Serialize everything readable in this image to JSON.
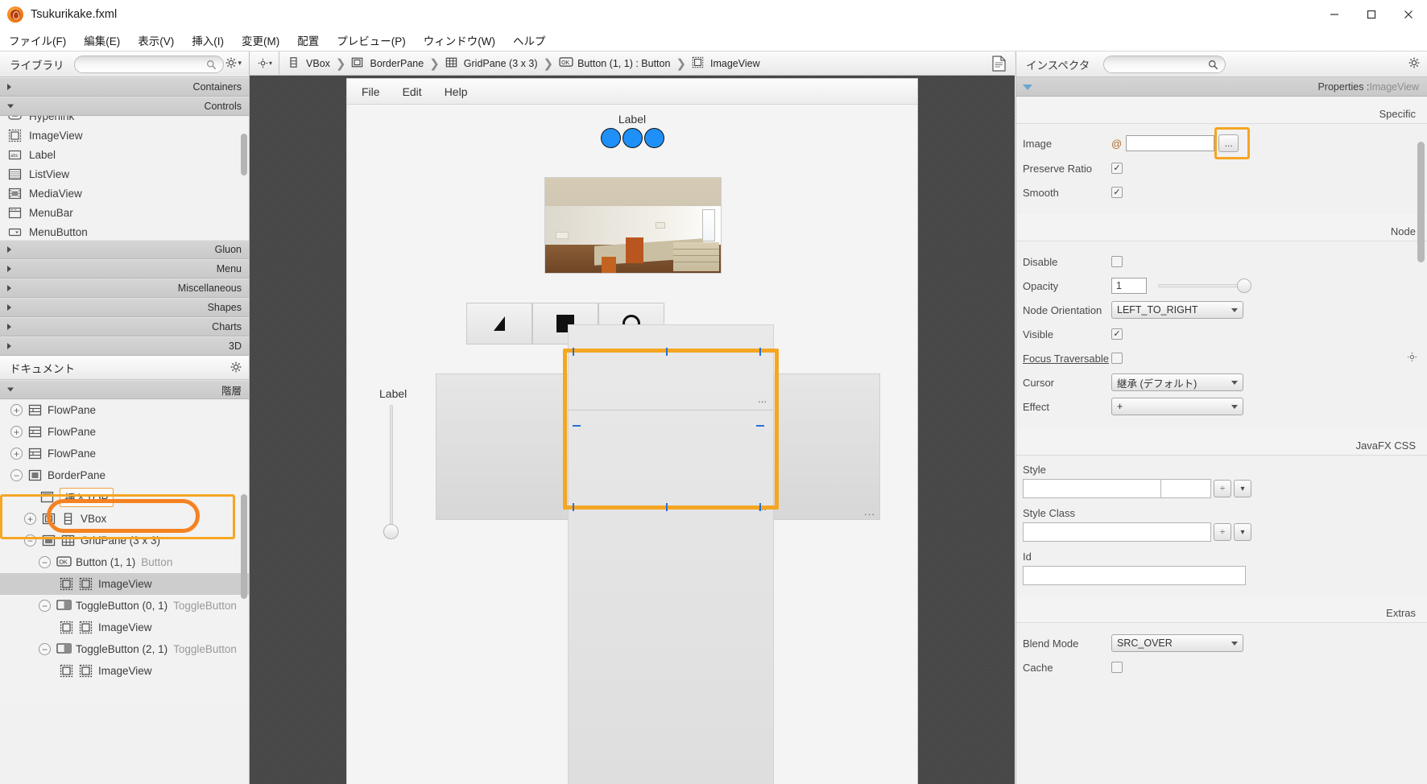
{
  "window": {
    "title": "Tsukurikake.fxml",
    "app_icon": "scenebuilder-icon",
    "minimize": "−",
    "maximize": "▢",
    "close": "✕"
  },
  "menubar": {
    "items": [
      {
        "label": "ファイル(F)",
        "name": "menu-file"
      },
      {
        "label": "編集(E)",
        "name": "menu-edit"
      },
      {
        "label": "表示(V)",
        "name": "menu-view"
      },
      {
        "label": "挿入(I)",
        "name": "menu-insert"
      },
      {
        "label": "変更(M)",
        "name": "menu-modify"
      },
      {
        "label": "配置",
        "name": "menu-arrange"
      },
      {
        "label": "プレビュー(P)",
        "name": "menu-preview"
      },
      {
        "label": "ウィンドウ(W)",
        "name": "menu-window"
      },
      {
        "label": "ヘルプ",
        "name": "menu-help"
      }
    ]
  },
  "library": {
    "title": "ライブラリ",
    "search_placeholder": "",
    "search_value": "",
    "sections": [
      {
        "label": "Containers",
        "expanded": false
      },
      {
        "label": "Controls",
        "expanded": true
      }
    ],
    "items": [
      {
        "label": "Hyperlink",
        "icon": "hyperlink-icon"
      },
      {
        "label": "ImageView",
        "icon": "imageview-icon"
      },
      {
        "label": "Label",
        "icon": "label-icon"
      },
      {
        "label": "ListView",
        "icon": "listview-icon"
      },
      {
        "label": "MediaView",
        "icon": "mediaview-icon"
      },
      {
        "label": "MenuBar",
        "icon": "menubar-icon"
      },
      {
        "label": "MenuButton",
        "icon": "menubutton-icon"
      }
    ],
    "sections_bottom": [
      {
        "label": "Gluon"
      },
      {
        "label": "Menu"
      },
      {
        "label": "Miscellaneous"
      },
      {
        "label": "Shapes"
      },
      {
        "label": "Charts"
      },
      {
        "label": "3D"
      }
    ]
  },
  "document": {
    "title": "ドキュメント",
    "section_label": "階層",
    "tree": [
      {
        "label": "FlowPane",
        "sub": "",
        "depth": 0,
        "expander": "+",
        "icons": [
          "flowpane-icon"
        ]
      },
      {
        "label": "FlowPane",
        "sub": "",
        "depth": 0,
        "expander": "+",
        "icons": [
          "flowpane-icon"
        ]
      },
      {
        "label": "FlowPane",
        "sub": "",
        "depth": 0,
        "expander": "+",
        "icons": [
          "flowpane-icon"
        ]
      },
      {
        "label": "BorderPane",
        "sub": "",
        "depth": 0,
        "expander": "-",
        "icons": [
          "borderpane-icon"
        ]
      },
      {
        "label": "挿入TOP",
        "sub": "",
        "depth": 1,
        "expander": "",
        "icons": [
          "borderpane-top-icon"
        ],
        "chip": true
      },
      {
        "label": "VBox",
        "sub": "",
        "depth": 1,
        "expander": "+",
        "icons": [
          "borderpane-center-icon",
          "vbox-icon"
        ]
      },
      {
        "label": "GridPane (3 x 3)",
        "sub": "",
        "depth": 1,
        "expander": "-",
        "icons": [
          "borderpane-bottom-icon",
          "gridpane-icon"
        ]
      },
      {
        "label": "Button (1, 1)",
        "sub": "Button",
        "depth": 2,
        "expander": "-",
        "icons": [
          "button-ok-icon"
        ]
      },
      {
        "label": "ImageView",
        "sub": "",
        "depth": 3,
        "expander": "",
        "icons": [
          "imageview-icon",
          "imageview-icon"
        ],
        "selected": true
      },
      {
        "label": "ToggleButton (0, 1)",
        "sub": "ToggleButton",
        "depth": 2,
        "expander": "-",
        "icons": [
          "togglebutton-icon"
        ]
      },
      {
        "label": "ImageView",
        "sub": "",
        "depth": 3,
        "expander": "",
        "icons": [
          "imageview-icon",
          "imageview-icon"
        ]
      },
      {
        "label": "ToggleButton (2, 1)",
        "sub": "ToggleButton",
        "depth": 2,
        "expander": "-",
        "icons": [
          "togglebutton-icon"
        ]
      },
      {
        "label": "ImageView",
        "sub": "",
        "depth": 3,
        "expander": "",
        "icons": [
          "imageview-icon",
          "imageview-icon"
        ]
      }
    ]
  },
  "breadcrumb": {
    "items": [
      {
        "label": "VBox",
        "icon": "vbox-icon"
      },
      {
        "label": "BorderPane",
        "icon": "borderpane-icon"
      },
      {
        "label": "GridPane (3 x 3)",
        "icon": "gridpane-icon"
      },
      {
        "label": "Button (1, 1) : Button",
        "icon": "button-ok-icon"
      },
      {
        "label": "ImageView",
        "icon": "imageview-icon"
      }
    ],
    "separator": "❯",
    "left_icon": "gear-dropdown-icon",
    "right_icon": "document-preview-icon"
  },
  "canvas": {
    "stage": {
      "menu": [
        "File",
        "Edit",
        "Help"
      ],
      "top_label": "Label",
      "circle_count": 3,
      "circle_color": "#1e90f8",
      "grid_label": "Label",
      "cell_dots": "...",
      "photo_alt": "room-photo"
    }
  },
  "inspector": {
    "title": "インスペクタ",
    "search_value": "",
    "header": {
      "prefix": "Properties : ",
      "target": "ImageView"
    },
    "groups": [
      {
        "label": "Specific"
      },
      {
        "label": "Node"
      },
      {
        "label": "JavaFX CSS"
      },
      {
        "label": "Extras"
      }
    ],
    "specific": [
      {
        "label": "Image",
        "type": "image-field",
        "prefix": "@",
        "value": "",
        "browse": "...",
        "highlighted": true
      },
      {
        "label": "Preserve Ratio",
        "type": "checkbox",
        "checked": true,
        "mark": "✓"
      },
      {
        "label": "Smooth",
        "type": "checkbox",
        "checked": true,
        "mark": "✓"
      }
    ],
    "node": [
      {
        "label": "Disable",
        "type": "checkbox",
        "checked": false,
        "mark": ""
      },
      {
        "label": "Opacity",
        "type": "number-slider",
        "value": "1"
      },
      {
        "label": "Node Orientation",
        "type": "combo",
        "value": "LEFT_TO_RIGHT"
      },
      {
        "label": "Visible",
        "type": "checkbox",
        "checked": true,
        "mark": "✓"
      },
      {
        "label": "Focus Traversable",
        "type": "checkbox",
        "checked": false,
        "mark": "",
        "underline": true,
        "gear": "gear-icon"
      },
      {
        "label": "Cursor",
        "type": "combo",
        "value": "継承 (デフォルト)"
      },
      {
        "label": "Effect",
        "type": "combo",
        "value": "+"
      }
    ],
    "css": [
      {
        "label": "Style",
        "type": "style-row",
        "value": ""
      },
      {
        "label": "Style Class",
        "type": "style-row",
        "value": ""
      },
      {
        "label": "Id",
        "type": "text",
        "value": ""
      }
    ],
    "extras": [
      {
        "label": "Blend Mode",
        "type": "combo",
        "value": "SRC_OVER"
      },
      {
        "label": "Cache",
        "type": "checkbox",
        "checked": false,
        "mark": ""
      }
    ],
    "add_symbol": "+",
    "minus_symbol": "÷",
    "dropdown_symbol": "▾"
  }
}
